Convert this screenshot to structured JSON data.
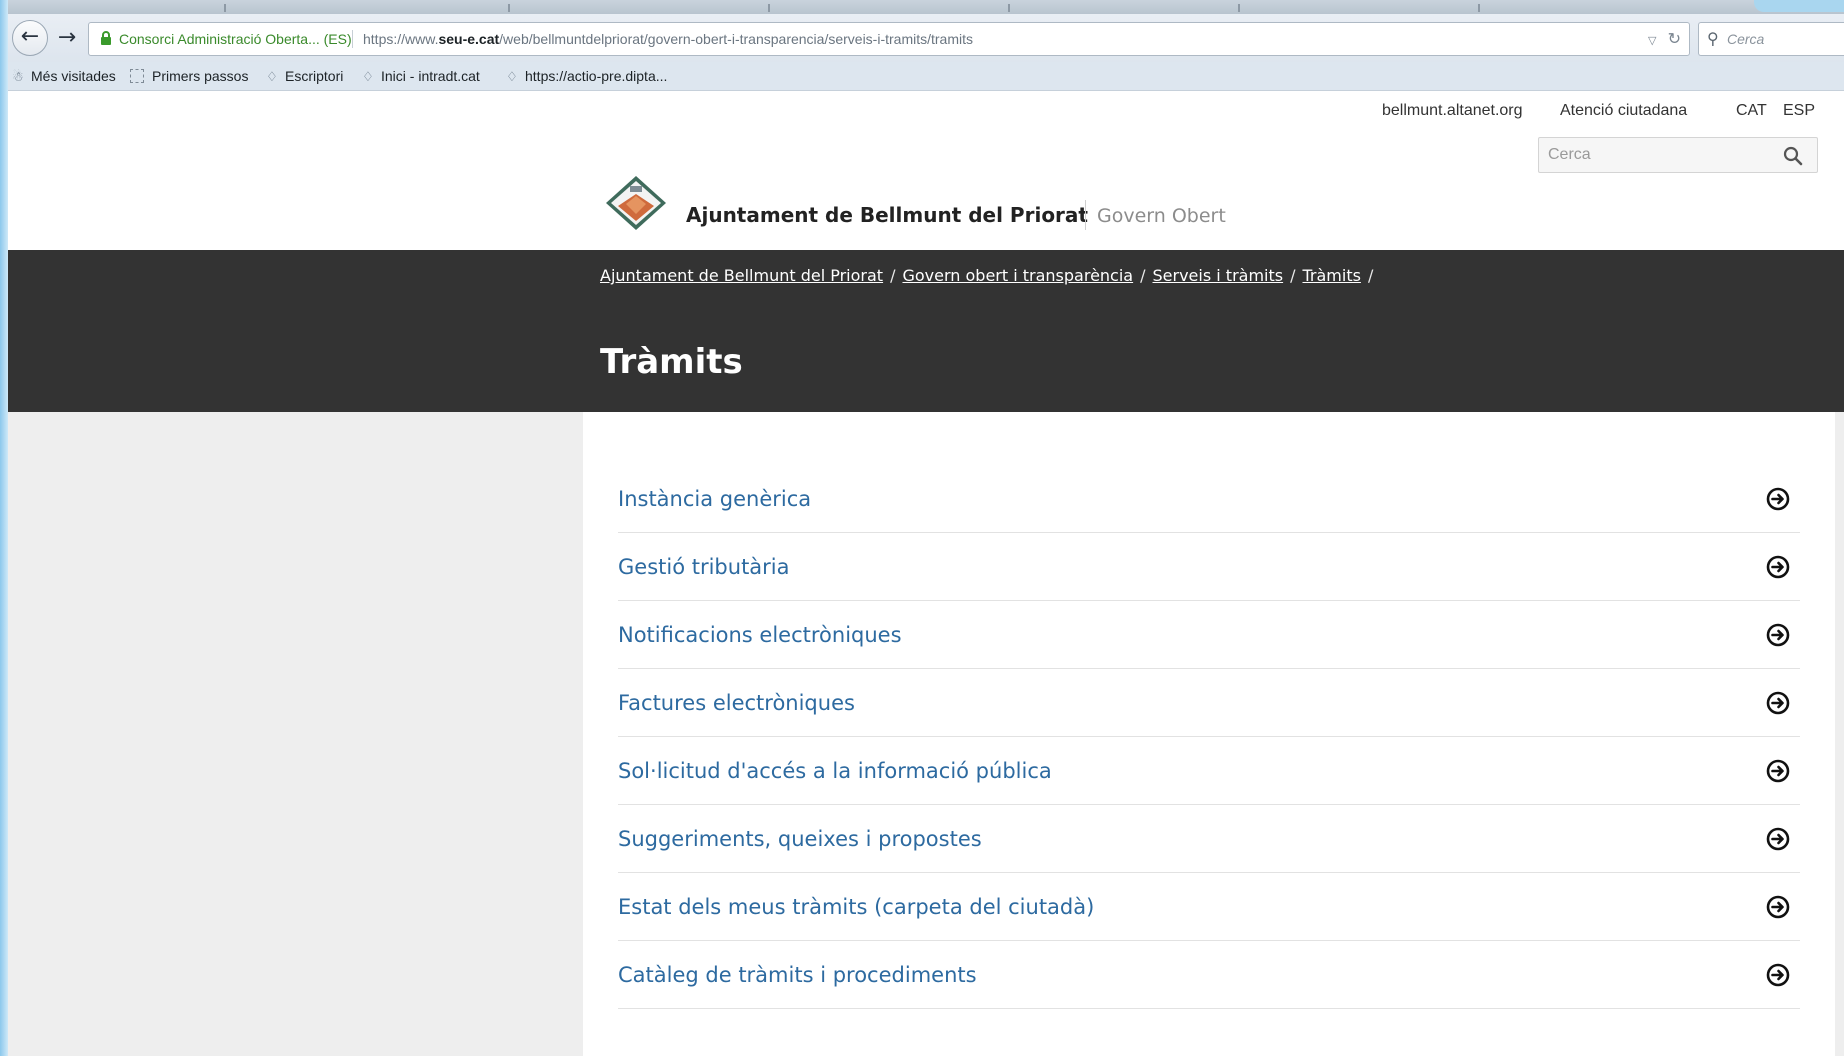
{
  "browser": {
    "site_identity": "Consorci Administració Oberta... (ES)",
    "url_prefix": "https://www.",
    "url_domain": "seu-e.cat",
    "url_path": "/web/bellmuntdelpriorat/govern-obert-i-transparencia/serveis-i-tramits/tramits",
    "search_placeholder": "Cerca"
  },
  "bookmarks": [
    {
      "label": "Més visitades",
      "icon": "bookmark-folder-icon"
    },
    {
      "label": "Primers passos",
      "icon": "page-icon"
    },
    {
      "label": "Escriptori",
      "icon": "app-icon"
    },
    {
      "label": "Inici - intradt.cat",
      "icon": "app-icon"
    },
    {
      "label": "https://actio-pre.dipta...",
      "icon": "app-icon"
    }
  ],
  "header": {
    "links": [
      "bellmunt.altanet.org",
      "Atenció ciutadana"
    ],
    "languages": [
      "CAT",
      "ESP"
    ],
    "search_placeholder": "Cerca",
    "site_name": "Ajuntament de Bellmunt del Priorat",
    "site_subtitle": "Govern Obert"
  },
  "breadcrumb": [
    "Ajuntament de Bellmunt del Priorat",
    "Govern obert i transparència",
    "Serveis i tràmits",
    "Tràmits"
  ],
  "page_title": "Tràmits",
  "procedures": [
    "Instància genèrica",
    "Gestió tributària",
    "Notificacions electròniques",
    "Factures electròniques",
    "Sol·licitud d'accés a la informació pública",
    "Suggeriments, queixes i propostes",
    "Estat dels meus tràmits (carpeta del ciutadà)",
    "Catàleg de tràmits i procediments"
  ],
  "colors": {
    "dark_band": "#333333",
    "link_blue": "#2d6aa0",
    "sidebar_grey": "#eeeeee",
    "secure_green": "#3a8a2b"
  }
}
